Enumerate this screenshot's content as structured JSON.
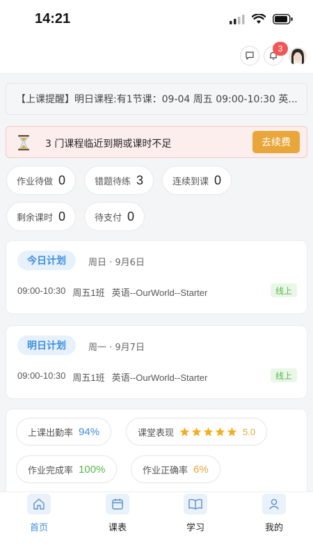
{
  "status_bar": {
    "time": "14:21"
  },
  "header": {
    "notification_count": "3"
  },
  "reminder": {
    "text": "【上课提醒】明日课程:有1节课：09-04 周五 09:00-10:30 英..."
  },
  "alert": {
    "text": "3 门课程临近到期或课时不足",
    "button": "去续费"
  },
  "summary": [
    {
      "label": "作业待做",
      "value": "0"
    },
    {
      "label": "错题待练",
      "value": "3"
    },
    {
      "label": "连续到课",
      "value": "0"
    },
    {
      "label": "剩余课时",
      "value": "0"
    },
    {
      "label": "待支付",
      "value": "0"
    }
  ],
  "plans": [
    {
      "tag": "今日计划",
      "date": "周日 · 9月6日",
      "time": "09:00-10:30",
      "class": "周五1班",
      "course": "英语--OurWorld--Starter",
      "mode": "线上"
    },
    {
      "tag": "明日计划",
      "date": "周一 · 9月7日",
      "time": "09:00-10:30",
      "class": "周五1班",
      "course": "英语--OurWorld--Starter",
      "mode": "线上"
    }
  ],
  "stats": {
    "attendance": {
      "label": "上课出勤率",
      "value": "94%"
    },
    "performance": {
      "label": "课堂表现",
      "stars": 5,
      "score": "5.0"
    },
    "completion": {
      "label": "作业完成率",
      "value": "100%"
    },
    "accuracy": {
      "label": "作业正确率",
      "value": "6%"
    }
  },
  "tabbar": [
    {
      "label": "首页",
      "icon": "home-icon",
      "active": true
    },
    {
      "label": "课表",
      "icon": "calendar-icon",
      "active": false
    },
    {
      "label": "学习",
      "icon": "book-icon",
      "active": false
    },
    {
      "label": "我的",
      "icon": "user-icon",
      "active": false
    }
  ],
  "colors": {
    "accent": "#3d8ee0",
    "warning": "#e8a63b",
    "success": "#58b64d",
    "danger": "#ef5757"
  }
}
